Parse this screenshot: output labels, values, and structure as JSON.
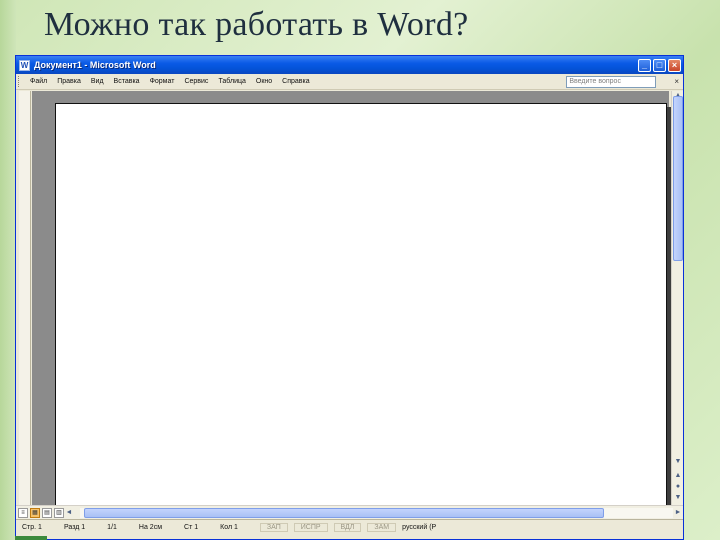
{
  "slide": {
    "title": "Можно так работать в Word?"
  },
  "window": {
    "title": "Документ1 - Microsoft Word",
    "icon_letter": "W",
    "minimize_icon": "minimize-icon",
    "maximize_icon": "maximize-icon",
    "close_icon": "close-icon"
  },
  "menu": {
    "items": [
      "Файл",
      "Правка",
      "Вид",
      "Вставка",
      "Формат",
      "Сервис",
      "Таблица",
      "Окно",
      "Справка"
    ],
    "help_placeholder": "Введите вопрос",
    "close_glyph": "×"
  },
  "scroll": {
    "up_glyph": "▲",
    "down_glyph": "▼",
    "left_glyph": "◄",
    "right_glyph": "►",
    "prev_page_glyph": "▲",
    "next_page_glyph": "▼"
  },
  "view_buttons": [
    "≡",
    "▦",
    "▤",
    "▥"
  ],
  "status": {
    "page": "Стр. 1",
    "section": "Разд 1",
    "pages": "1/1",
    "at": "На 2см",
    "line": "Ст 1",
    "col": "Кол 1",
    "rec": "ЗАП",
    "trk": "ИСПР",
    "ext": "ВДЛ",
    "ovr": "ЗАМ",
    "language": "русский (Р"
  },
  "colors": {
    "titlebar": "#0453d8",
    "slide_bg": "#d6ebc0",
    "document_bg": "#8b8b8b"
  }
}
